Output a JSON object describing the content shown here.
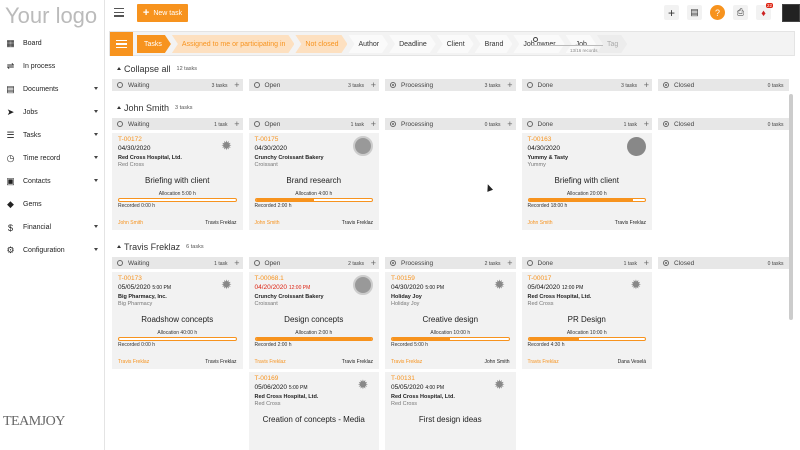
{
  "app": {
    "logo_text": "Your logo",
    "bottom_logo_text": "TEAMJOY"
  },
  "sidebar": {
    "items": [
      {
        "label": "Board",
        "icon": "grid-icon",
        "arrow": false
      },
      {
        "label": "In process",
        "icon": "process-icon",
        "arrow": false
      },
      {
        "label": "Documents",
        "icon": "document-icon",
        "arrow": true
      },
      {
        "label": "Jobs",
        "icon": "rocket-icon",
        "arrow": true
      },
      {
        "label": "Tasks",
        "icon": "tasks-icon",
        "arrow": true
      },
      {
        "label": "Time record",
        "icon": "clock-icon",
        "arrow": true
      },
      {
        "label": "Contacts",
        "icon": "contacts-icon",
        "arrow": true
      },
      {
        "label": "Gems",
        "icon": "gem-icon",
        "arrow": false
      },
      {
        "label": "Financial",
        "icon": "dollar-icon",
        "arrow": true
      },
      {
        "label": "Configuration",
        "icon": "gear-icon",
        "arrow": true
      }
    ]
  },
  "toolbar": {
    "new_task_label": "New task",
    "notification_count": "22"
  },
  "filters": {
    "crumbs": [
      "Tasks",
      "Assigned to me or participating in",
      "Not closed",
      "Author",
      "Deadline",
      "Client",
      "Brand",
      "Job owner",
      "Job",
      "Tag"
    ],
    "search_placeholder": "",
    "records": "13/16 records"
  },
  "columns": [
    "Waiting",
    "Open",
    "Processing",
    "Done",
    "Closed"
  ],
  "groups": [
    {
      "title": "Collapse all",
      "count": "12 tasks",
      "col_counts": [
        "3 tasks",
        "3 tasks",
        "3 tasks",
        "3 tasks",
        "0 tasks"
      ],
      "cards": []
    },
    {
      "title": "John Smith",
      "count": "3 tasks",
      "col_counts": [
        "1 task",
        "1 task",
        "0 tasks",
        "1 task",
        "0 tasks"
      ],
      "cards": [
        {
          "col": 0,
          "id": "T-00172",
          "date": "04/30/2020",
          "time": "",
          "overdue": "",
          "org": "Red Cross Hospital, Ltd.",
          "sub": "Red Cross",
          "name": "Briefing with client",
          "alloc": "Allocation 5:00 h",
          "progress": 0,
          "rec": "Recorded 0:00 h",
          "author": "John Smith",
          "owner": "Travis Freklaz",
          "logo": "red-cross-logo-icon"
        },
        {
          "col": 1,
          "id": "T-00175",
          "date": "04/30/2020",
          "time": "",
          "overdue": "",
          "org": "Crunchy Croissant Bakery",
          "sub": "Croissant",
          "name": "Brand research",
          "alloc": "Allocation 4:00 h",
          "progress": 0.5,
          "rec": "Recorded 2:00 h",
          "author": "John Smith",
          "owner": "Travis Freklaz",
          "logo": "bakery-logo-icon"
        },
        {
          "col": 3,
          "id": "T-00163",
          "date": "04/30/2020",
          "time": "",
          "overdue": "",
          "org": "Yummy & Tasty",
          "sub": "Yummy",
          "name": "Briefing with client",
          "alloc": "Allocation 20:00 h",
          "progress": 0.9,
          "rec": "Recorded 18:00 h",
          "author": "John Smith",
          "owner": "Travis Freklaz",
          "logo": "yummy-logo-icon"
        }
      ]
    },
    {
      "title": "Travis Freklaz",
      "count": "6 tasks",
      "col_counts": [
        "1 task",
        "2 tasks",
        "2 tasks",
        "1 task",
        "0 tasks"
      ],
      "cards": [
        {
          "col": 0,
          "id": "T-00173",
          "date": "05/05/2020",
          "time": "5:00 PM",
          "overdue": "",
          "org": "Big Pharmacy, Inc.",
          "sub": "Big Pharmacy",
          "name": "Roadshow concepts",
          "alloc": "Allocation 40:00 h",
          "progress": 0,
          "rec": "Recorded 0:00 h",
          "author": "Travis Freklaz",
          "owner": "Travis Freklaz",
          "logo": "pharmacy-logo-icon"
        },
        {
          "col": 1,
          "id": "T-00068.1",
          "date": "04/20/2020",
          "time": "12:00 PM",
          "overdue": "true",
          "org": "Crunchy Croissant Bakery",
          "sub": "Croissant",
          "name": "Design concepts",
          "alloc": "Allocation 2:00 h",
          "progress": 1,
          "rec": "Recorded 2:00 h",
          "author": "Travis Freklaz",
          "owner": "Travis Freklaz",
          "logo": "bakery-logo-icon"
        },
        {
          "col": 2,
          "id": "T-00159",
          "date": "04/30/2020",
          "time": "5:00 PM",
          "overdue": "",
          "org": "Holiday Joy",
          "sub": "Holiday Joy",
          "name": "Creative design",
          "alloc": "Allocation 10:00 h",
          "progress": 0.5,
          "rec": "Recorded 5:00 h",
          "author": "Travis Freklaz",
          "owner": "John Smith",
          "logo": "holiday-joy-logo-icon"
        },
        {
          "col": 3,
          "id": "T-00017",
          "date": "05/04/2020",
          "time": "12:00 PM",
          "overdue": "",
          "org": "Red Cross Hospital, Ltd.",
          "sub": "Red Cross",
          "name": "PR Design",
          "alloc": "Allocation 10:00 h",
          "progress": 0.43,
          "rec": "Recorded 4:30 h",
          "author": "Travis Freklaz",
          "owner": "Dana Veselá",
          "logo": "red-cross-logo-icon"
        },
        {
          "col": 1,
          "id": "T-00169",
          "date": "05/06/2020",
          "time": "5:00 PM",
          "overdue": "",
          "org": "Red Cross Hospital, Ltd.",
          "sub": "Red Cross",
          "name": "Creation of concepts - Media",
          "alloc": "",
          "progress": 0,
          "rec": "",
          "author": "",
          "owner": "",
          "logo": "red-cross-logo-icon"
        },
        {
          "col": 2,
          "id": "T-00131",
          "date": "05/05/2020",
          "time": "4:00 PM",
          "overdue": "",
          "org": "Red Cross Hospital, Ltd.",
          "sub": "Red Cross",
          "name": "First design ideas",
          "alloc": "",
          "progress": 0,
          "rec": "",
          "author": "",
          "owner": "",
          "logo": "red-cross-logo-icon"
        }
      ]
    }
  ]
}
